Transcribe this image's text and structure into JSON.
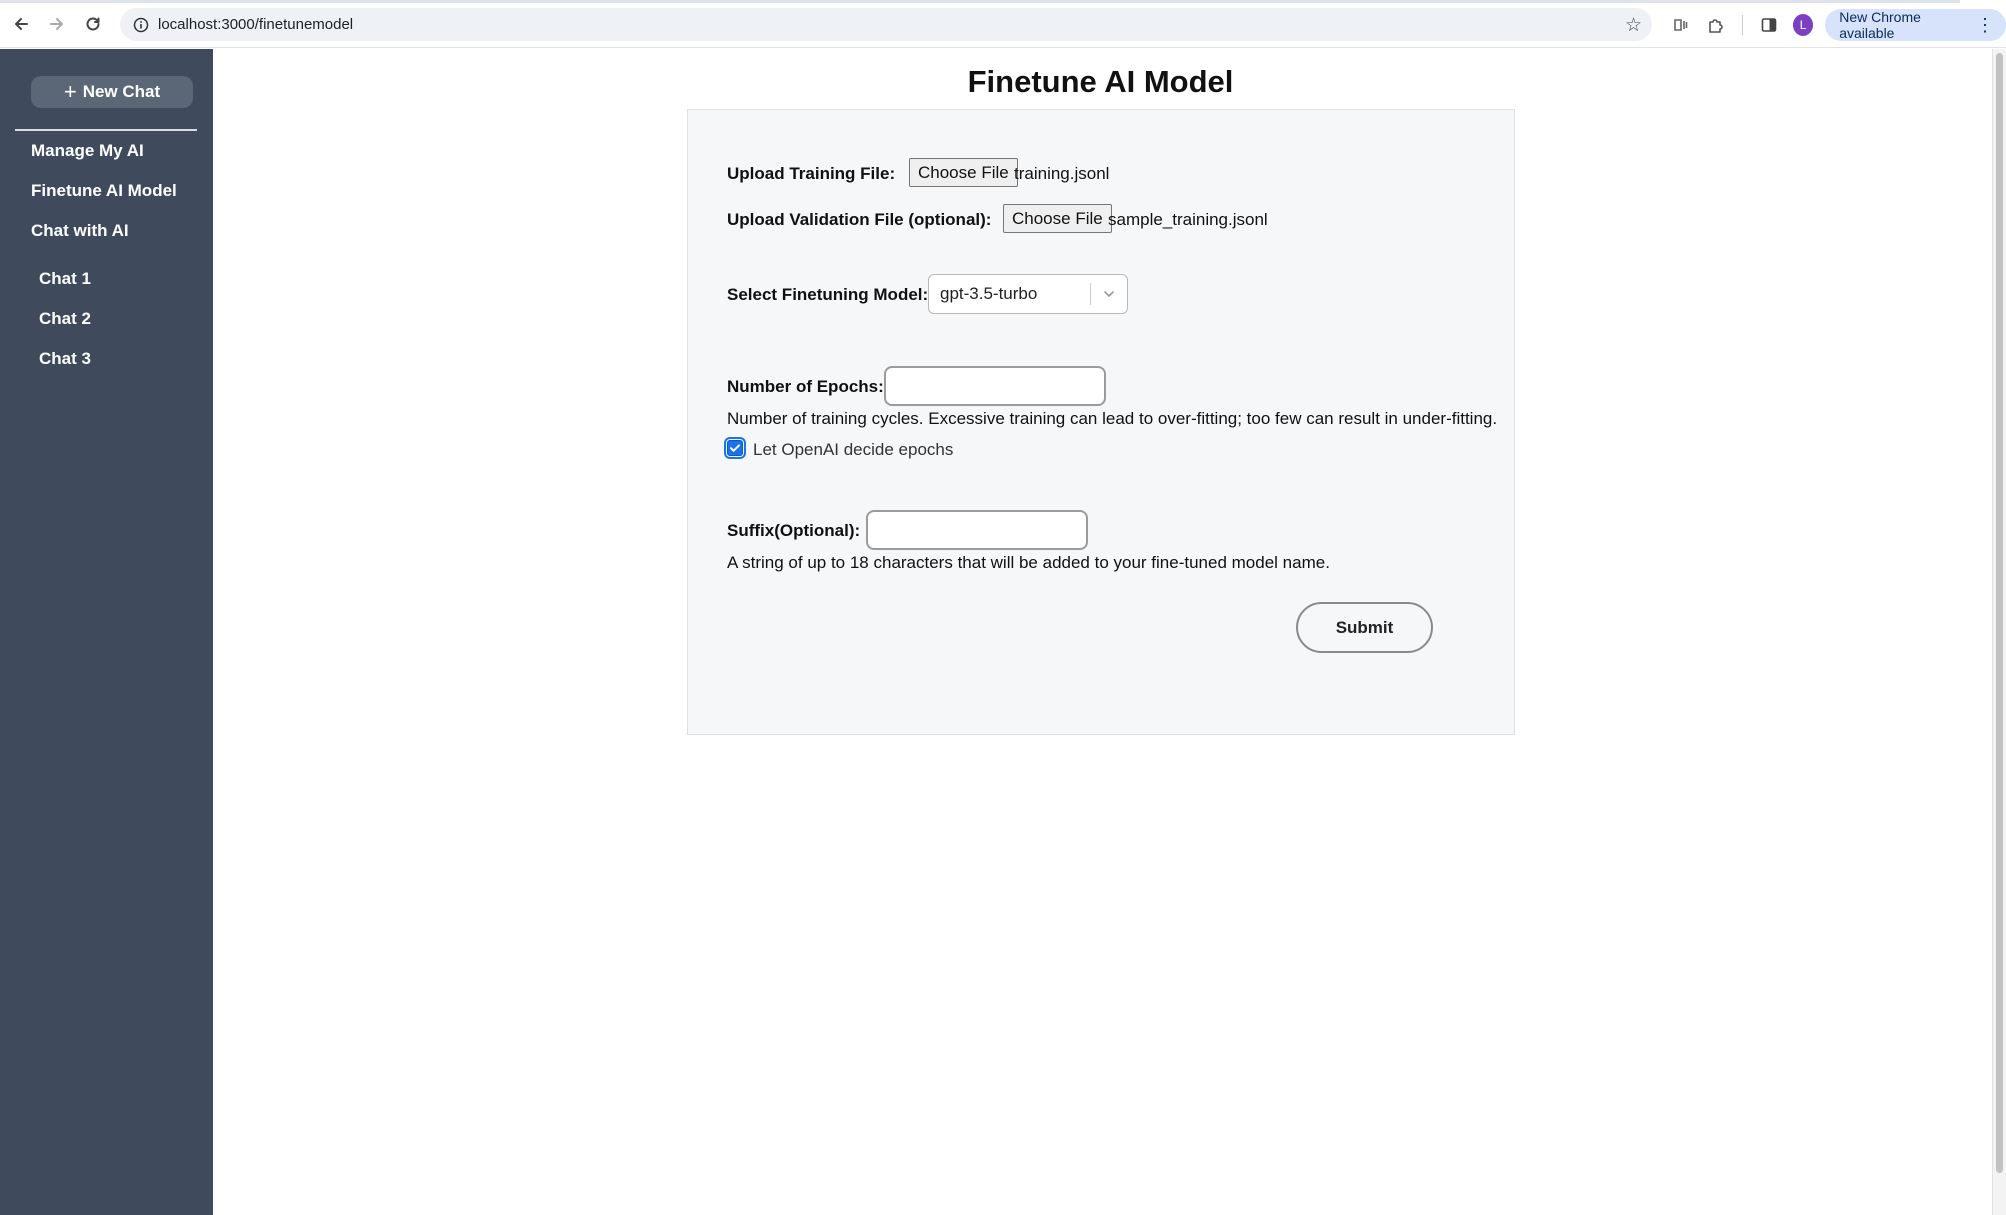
{
  "browser": {
    "url": "localhost:3000/finetunemodel",
    "profile_initial": "L",
    "update_label": "New Chrome available"
  },
  "sidebar": {
    "new_chat_label": "New Chat",
    "links": [
      "Manage My AI",
      "Finetune AI Model",
      "Chat with AI"
    ],
    "chats": [
      "Chat 1",
      "Chat 2",
      "Chat 3"
    ]
  },
  "main": {
    "title": "Finetune AI Model",
    "training_file": {
      "label": "Upload Training File:",
      "button": "Choose File",
      "file_name": "training.jsonl"
    },
    "validation_file": {
      "label": "Upload Validation File (optional):",
      "button": "Choose File",
      "file_name": "sample_training.jsonl"
    },
    "model_select": {
      "label": "Select Finetuning Model:",
      "value": "gpt-3.5-turbo"
    },
    "epochs": {
      "label": "Number of Epochs:",
      "value": "",
      "help": "Number of training cycles. Excessive training can lead to over-fitting; too few can result in under-fitting.",
      "auto_label": "Let OpenAI decide epochs",
      "auto_checked": true
    },
    "suffix": {
      "label": "Suffix(Optional):",
      "value": "",
      "help": "A string of up to 18 characters that will be added to your fine-tuned model name."
    },
    "submit_label": "Submit"
  }
}
